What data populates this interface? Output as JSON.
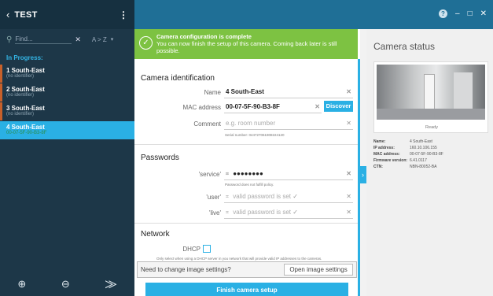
{
  "sidebar": {
    "title": "TEST",
    "search_placeholder": "Find...",
    "sort_label": "A > Z",
    "section_label": "In Progress:",
    "cameras": [
      {
        "name": "1 South-East",
        "sub": "(no identifier)"
      },
      {
        "name": "2 South-East",
        "sub": "(no identifier)"
      },
      {
        "name": "3 South-East",
        "sub": "(no identifier)"
      },
      {
        "name": "4 South-East",
        "sub": "00-07-5F-90-B3-8F"
      }
    ]
  },
  "banner": {
    "title": "Camera configuration is complete",
    "text": "You can now finish the setup of this camera. Coming back later is still possible."
  },
  "identification": {
    "section_title": "Camera identification",
    "name_label": "Name",
    "name_value": "4 South-East",
    "mac_label": "MAC address",
    "mac_value": "00-07-5F-90-B3-8F",
    "discover_label": "Discover",
    "comment_label": "Comment",
    "comment_placeholder": "e.g. room number",
    "serial": "Serial number: 044727061908224120"
  },
  "passwords": {
    "section_title": "Passwords",
    "service_label": "'service'",
    "service_value": "●●●●●●●●",
    "policy_note": "Password does not fulfill policy.",
    "user_label": "'user'",
    "user_value": "valid password is set",
    "live_label": "'live'",
    "live_value": "valid password is set"
  },
  "network": {
    "section_title": "Network",
    "dhcp_label": "DHCP",
    "dhcp_note": "Only select when using a DHCP server in you network that will provide valid IP addresses to the cameras."
  },
  "image_settings": {
    "question": "Need to change image settings?",
    "button": "Open image settings"
  },
  "finish_label": "Finish camera setup",
  "status": {
    "title": "Camera status",
    "ready": "Ready",
    "rows": [
      {
        "k": "Name:",
        "v": "4 South-East"
      },
      {
        "k": "IP address:",
        "v": "160.10.106.155"
      },
      {
        "k": "MAC address:",
        "v": "00-07-5F-90-B3-8F"
      },
      {
        "k": "Firmware version:",
        "v": "6.41.0117"
      },
      {
        "k": "CTN:",
        "v": "NBN-80052-BA"
      }
    ]
  },
  "colors": {
    "accent": "#2ab0e4",
    "banner": "#7dc242",
    "sidebar": "#1d3748",
    "topbar": "#1f6f96"
  }
}
